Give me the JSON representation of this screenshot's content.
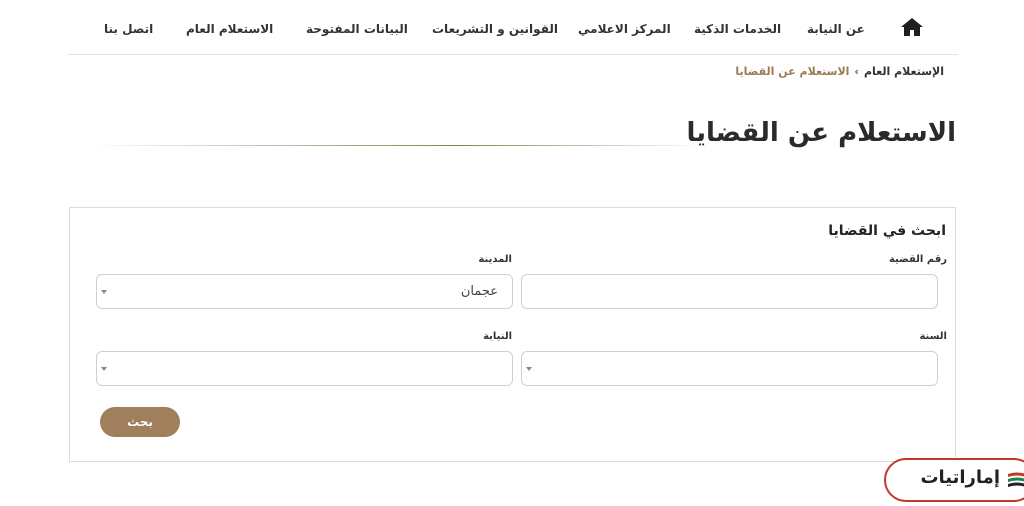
{
  "nav": {
    "items": [
      {
        "label": "عن النيابة"
      },
      {
        "label": "الخدمات الذكية"
      },
      {
        "label": "المركز الاعلامي"
      },
      {
        "label": "القوانين و التشريعات"
      },
      {
        "label": "البيانات المفتوحة"
      },
      {
        "label": "الاستعلام العام"
      },
      {
        "label": "اتصل بنا"
      }
    ]
  },
  "breadcrumb": {
    "items": [
      "الإستعلام العام",
      "الاستعلام عن القضايا"
    ],
    "separator": "›"
  },
  "page": {
    "title": "الاستعلام عن القضايا"
  },
  "search": {
    "title": "ابحث في القضايا",
    "case_number": {
      "label": "رقم القضية",
      "value": ""
    },
    "city": {
      "label": "المدينة",
      "value": "عجمان"
    },
    "year": {
      "label": "السنة",
      "value": ""
    },
    "prosecution": {
      "label": "النيابة",
      "value": ""
    },
    "submit_label": "بحث"
  },
  "watermark": {
    "text": "إماراتيات"
  },
  "colors": {
    "accent": "#a0805c",
    "breadcrumb_active": "#9a7b54",
    "logo_border": "#c0392b"
  }
}
